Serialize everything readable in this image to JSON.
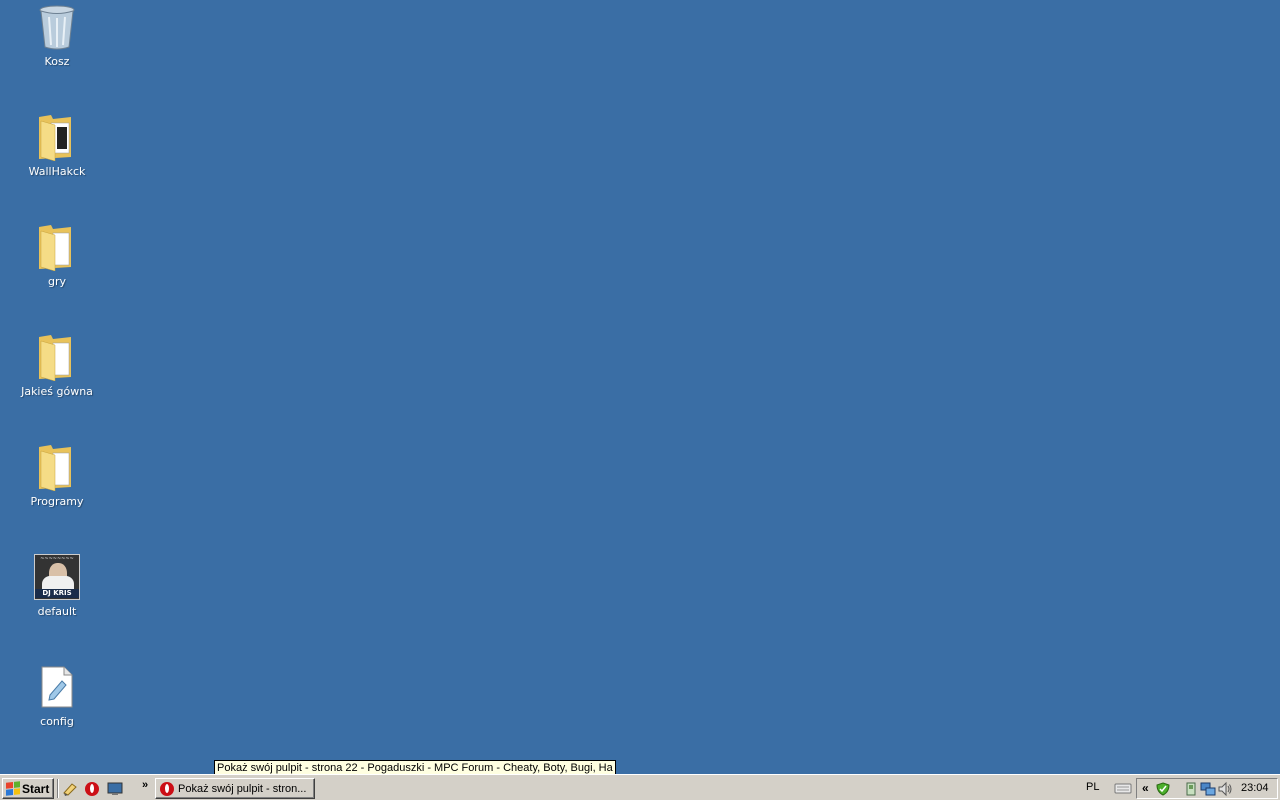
{
  "desktop": {
    "background_color": "#3a6ea5",
    "icons": [
      {
        "label": "Kosz",
        "icon": "recycle-bin-icon"
      },
      {
        "label": "WallHakck",
        "icon": "folder-icon"
      },
      {
        "label": "gry",
        "icon": "folder-icon"
      },
      {
        "label": "Jakieś gówna",
        "icon": "folder-icon"
      },
      {
        "label": "Programy",
        "icon": "folder-icon"
      },
      {
        "label": "default",
        "icon": "image-thumbnail-icon",
        "thumb_text": "DJ KRIS"
      },
      {
        "label": "config",
        "icon": "text-document-icon"
      }
    ]
  },
  "tooltip": {
    "text": "Pokaż swój pulpit - strona 22 - Pogaduszki - MPC Forum - Cheaty, Boty, Bugi, Ha"
  },
  "taskbar": {
    "start_label": "Start",
    "quick_launch": [
      "show-desktop-icon",
      "opera-icon",
      "screen-icon"
    ],
    "overflow_label": "»",
    "task_button_label": "Pokaż swój pulpit - stron...",
    "language": "PL",
    "tray_expand_label": "«",
    "tray_icons": [
      "green-shield-icon",
      "device-icon",
      "network-icon",
      "volume-icon"
    ],
    "clock": "23:04"
  }
}
